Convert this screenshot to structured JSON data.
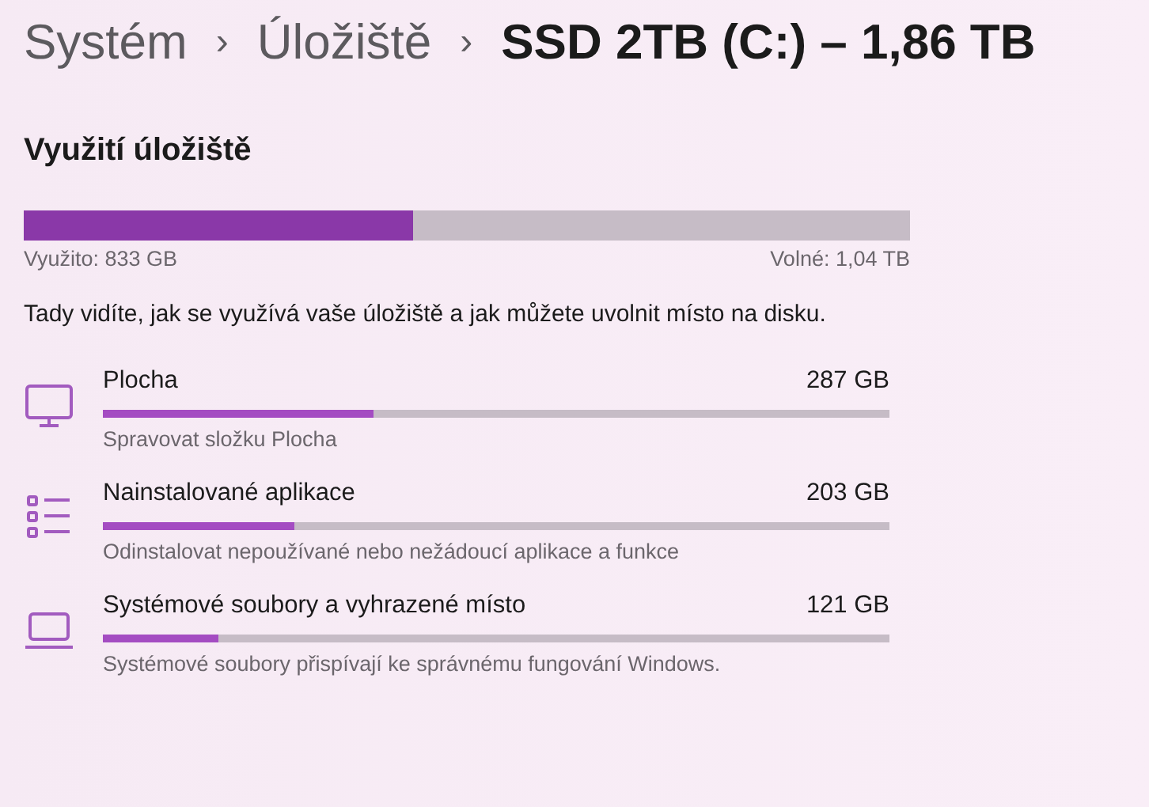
{
  "breadcrumb": [
    {
      "label": "Systém",
      "current": false
    },
    {
      "label": "Úložiště",
      "current": false
    },
    {
      "label": "SSD 2TB (C:) – 1,86 TB",
      "current": true
    }
  ],
  "separator": "›",
  "usage": {
    "title": "Využití úložiště",
    "level": 0.44,
    "used": "Využito: 833 GB",
    "free": "Volné: 1,04 TB",
    "description": "Tady vidíte, jak se využívá vaše úložiště a jak můžete uvolnit místo na disku."
  },
  "categories": [
    {
      "kind": "monitor",
      "name": "Plocha",
      "size": "287 GB",
      "level": 0.344,
      "description": "Spravovat složku Plocha"
    },
    {
      "kind": "list",
      "name": "Nainstalované aplikace",
      "size": "203 GB",
      "level": 0.243,
      "description": "Odinstalovat nepoužívané nebo nežádoucí aplikace a funkce"
    },
    {
      "kind": "laptop",
      "name": "Systémové soubory a vyhrazené místo",
      "size": "121 GB",
      "level": 0.147,
      "description": "Systémové soubory přispívají ke správnému fungování Windows."
    }
  ]
}
